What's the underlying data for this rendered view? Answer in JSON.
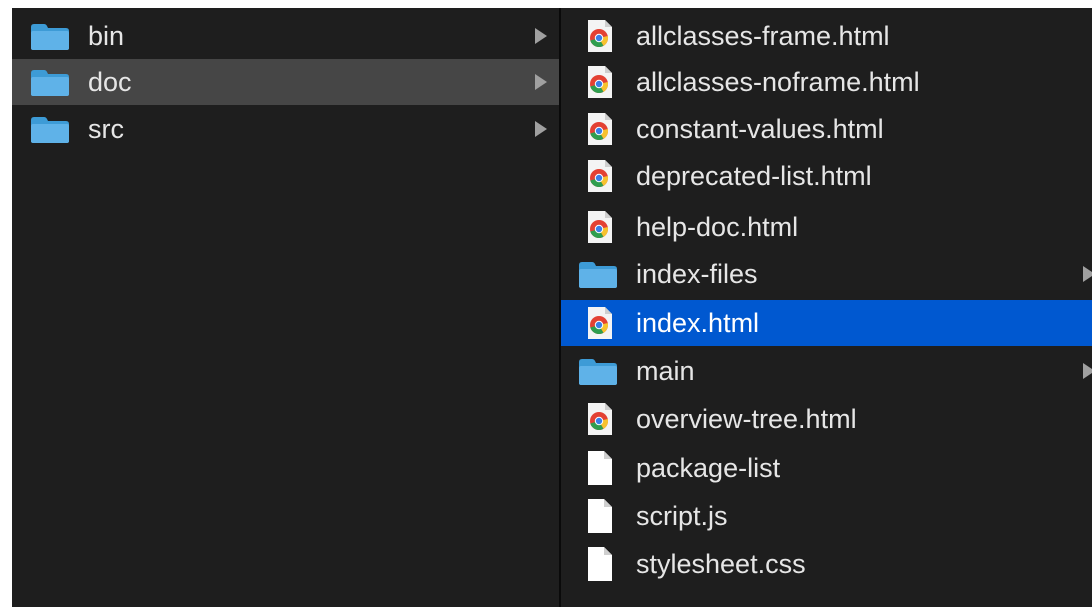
{
  "window": {
    "accent_color": "#0058d0",
    "inactive_selection_color": "#464646",
    "background_color": "#1e1e1e"
  },
  "column_1": {
    "items": [
      {
        "label": "bin",
        "icon": "folder-icon",
        "has_children": true,
        "selected": false
      },
      {
        "label": "doc",
        "icon": "folder-icon",
        "has_children": true,
        "selected": true
      },
      {
        "label": "src",
        "icon": "folder-icon",
        "has_children": true,
        "selected": false
      }
    ]
  },
  "column_2": {
    "items": [
      {
        "label": "allclasses-frame.html",
        "icon": "chrome-html-icon",
        "has_children": false,
        "selected": false
      },
      {
        "label": "allclasses-noframe.html",
        "icon": "chrome-html-icon",
        "has_children": false,
        "selected": false
      },
      {
        "label": "constant-values.html",
        "icon": "chrome-html-icon",
        "has_children": false,
        "selected": false
      },
      {
        "label": "deprecated-list.html",
        "icon": "chrome-html-icon",
        "has_children": false,
        "selected": false
      },
      {
        "label": "help-doc.html",
        "icon": "chrome-html-icon",
        "has_children": false,
        "selected": false
      },
      {
        "label": "index-files",
        "icon": "folder-icon",
        "has_children": true,
        "selected": false
      },
      {
        "label": "index.html",
        "icon": "chrome-html-icon",
        "has_children": false,
        "selected": true
      },
      {
        "label": "main",
        "icon": "folder-icon",
        "has_children": true,
        "selected": false
      },
      {
        "label": "overview-tree.html",
        "icon": "chrome-html-icon",
        "has_children": false,
        "selected": false
      },
      {
        "label": "package-list",
        "icon": "document-icon",
        "has_children": false,
        "selected": false
      },
      {
        "label": "script.js",
        "icon": "document-icon",
        "has_children": false,
        "selected": false
      },
      {
        "label": "stylesheet.css",
        "icon": "document-icon",
        "has_children": false,
        "selected": false
      }
    ]
  }
}
